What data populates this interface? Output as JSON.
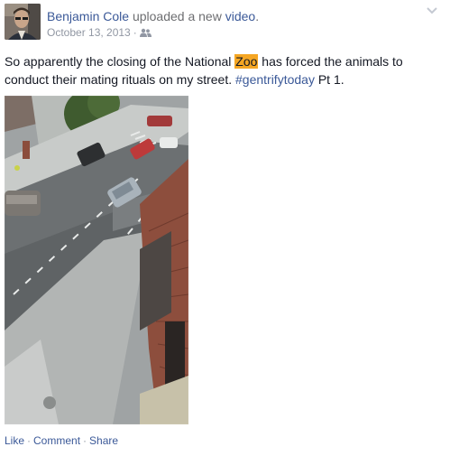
{
  "post": {
    "author": "Benjamin Cole",
    "action_prefix": "uploaded a new",
    "action_link": "video",
    "action_suffix": ".",
    "date": "October 13, 2013",
    "meta_separator": "·",
    "audience_icon": "friends-icon",
    "text": {
      "before": "So apparently the closing of the National ",
      "highlight": "Zoo",
      "after": " has forced the animals to conduct their mating rituals on my street. ",
      "hashtag": "#gentrifytoday",
      "end": " Pt 1."
    },
    "video": {
      "thumbnail_icon": "street-video-thumbnail"
    },
    "actions": {
      "like": "Like",
      "comment": "Comment",
      "share": "Share",
      "separator": "·"
    }
  },
  "colors": {
    "link": "#3b5998",
    "muted": "#9197a3",
    "highlight": "#f5a623",
    "text": "#141823"
  }
}
